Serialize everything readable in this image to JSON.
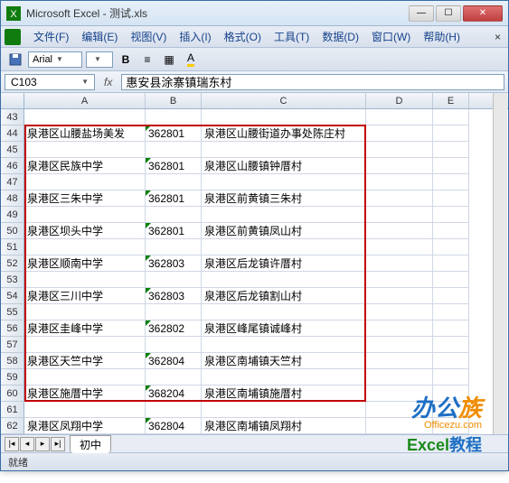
{
  "titlebar": {
    "title": "Microsoft Excel - 测试.xls"
  },
  "menu": {
    "file": "文件(F)",
    "edit": "编辑(E)",
    "view": "视图(V)",
    "insert": "插入(I)",
    "format": "格式(O)",
    "tools": "工具(T)",
    "data": "数据(D)",
    "window": "窗口(W)",
    "help": "帮助(H)",
    "close": "×"
  },
  "toolbar": {
    "font": "Arial"
  },
  "formula": {
    "namebox": "C103",
    "content": "惠安县涂寨镇瑞东村"
  },
  "columns": [
    "A",
    "B",
    "C",
    "D",
    "E"
  ],
  "chart_data": {
    "type": "table",
    "title": "测试.xls",
    "columns": [
      "A",
      "B",
      "C"
    ],
    "rows": [
      {
        "r": 43,
        "A": "",
        "B": "",
        "C": ""
      },
      {
        "r": 44,
        "A": "泉港区山腰盐场美发",
        "B": "362801",
        "C": "泉港区山腰街道办事处陈庄村"
      },
      {
        "r": 45,
        "A": "",
        "B": "",
        "C": ""
      },
      {
        "r": 46,
        "A": "泉港区民族中学",
        "B": "362801",
        "C": "泉港区山腰镇钟厝村"
      },
      {
        "r": 47,
        "A": "",
        "B": "",
        "C": ""
      },
      {
        "r": 48,
        "A": "泉港区三朱中学",
        "B": "362801",
        "C": "泉港区前黄镇三朱村"
      },
      {
        "r": 49,
        "A": "",
        "B": "",
        "C": ""
      },
      {
        "r": 50,
        "A": "泉港区坝头中学",
        "B": "362801",
        "C": "泉港区前黄镇凤山村"
      },
      {
        "r": 51,
        "A": "",
        "B": "",
        "C": ""
      },
      {
        "r": 52,
        "A": "泉港区顺南中学",
        "B": "362803",
        "C": "泉港区后龙镇许厝村"
      },
      {
        "r": 53,
        "A": "",
        "B": "",
        "C": ""
      },
      {
        "r": 54,
        "A": "泉港区三川中学",
        "B": "362803",
        "C": "泉港区后龙镇割山村"
      },
      {
        "r": 55,
        "A": "",
        "B": "",
        "C": ""
      },
      {
        "r": 56,
        "A": "泉港区圭峰中学",
        "B": "362802",
        "C": "泉港区峰尾镇诚峰村"
      },
      {
        "r": 57,
        "A": "",
        "B": "",
        "C": ""
      },
      {
        "r": 58,
        "A": "泉港区天竺中学",
        "B": "362804",
        "C": "泉港区南埔镇天竺村"
      },
      {
        "r": 59,
        "A": "",
        "B": "",
        "C": ""
      },
      {
        "r": 60,
        "A": "泉港区施厝中学",
        "B": "368204",
        "C": "泉港区南埔镇施厝村"
      },
      {
        "r": 61,
        "A": "",
        "B": "",
        "C": ""
      },
      {
        "r": 62,
        "A": "泉港区凤翔中学",
        "B": "362804",
        "C": "泉港区南埔镇凤翔村"
      }
    ]
  },
  "selection": {
    "top_row": 44,
    "bottom_row": 60
  },
  "tabs": {
    "active": "初中"
  },
  "status": {
    "text": "就绪"
  },
  "watermark": {
    "line1a": "办公",
    "line1b": "族",
    "line2": "Officezu.com",
    "line3a": "Excel",
    "line3b": "教程"
  }
}
